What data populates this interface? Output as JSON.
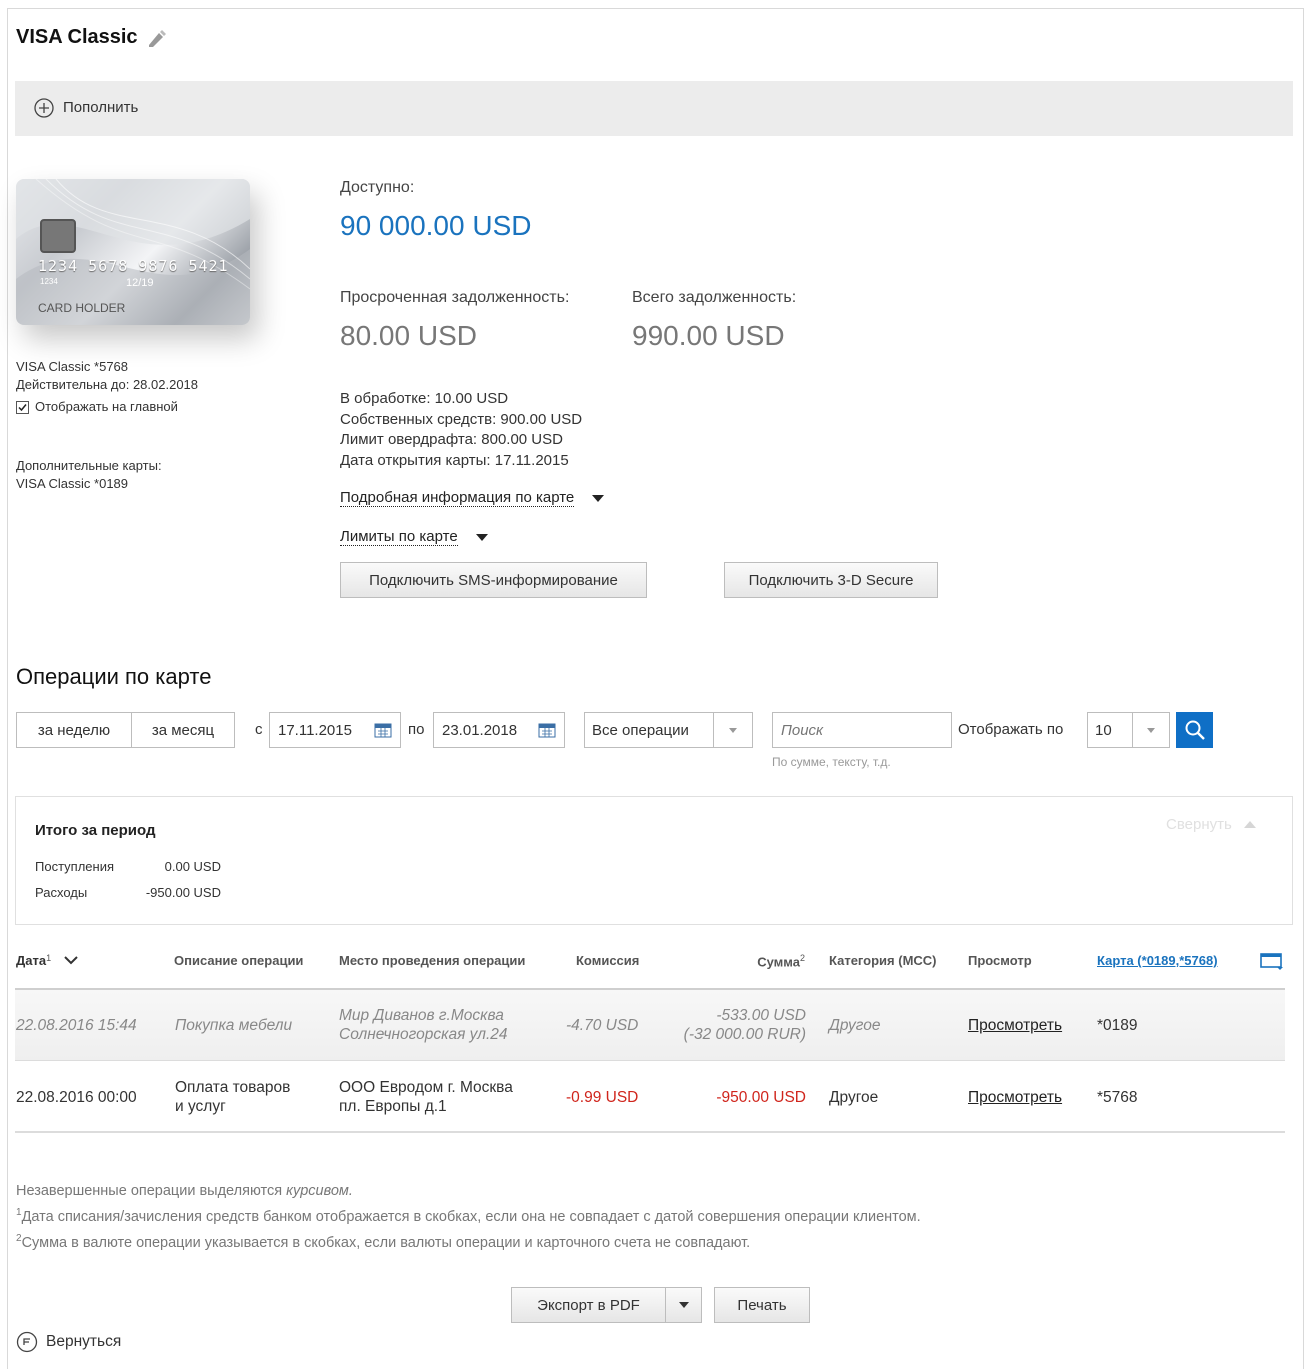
{
  "page": {
    "title": "VISA Classic",
    "topup_label": "Пополнить"
  },
  "card": {
    "image_number": "1234 5678 9876 5421",
    "image_small": "1234",
    "image_valid": "12/19",
    "image_holder": "CARD HOLDER",
    "name": "VISA Classic *5768",
    "valid_until": "Действительна до: 28.02.2018",
    "show_on_main_label": "Отображать на главной",
    "show_on_main_checked": true,
    "additional_title": "Дополнительные карты:",
    "additional_card": "VISA Classic *0189"
  },
  "balance": {
    "available_label": "Доступно:",
    "available_value": "90 000.00 USD",
    "overdue_label": "Просроченная задолженность:",
    "overdue_value": "80.00 USD",
    "total_debt_label": "Всего задолженность:",
    "total_debt_value": "990.00 USD",
    "processing": "В обработке: 10.00 USD",
    "own_funds": "Собственных средств: 900.00 USD",
    "overdraft": "Лимит овердрафта: 800.00 USD",
    "opened": "Дата открытия карты: 17.11.2015",
    "details_link": "Подробная информация по карте",
    "limits_link": "Лимиты по карте",
    "sms_button": "Подключить SMS-информирование",
    "secure_button": "Подключить 3-D Secure"
  },
  "operations": {
    "title": "Операции по карте",
    "week_button": "за неделю",
    "month_button": "за месяц",
    "from_label": "с",
    "date_from": "17.11.2015",
    "to_label": "по",
    "date_to": "23.01.2018",
    "type_select": "Все операции",
    "search_placeholder": "Поиск",
    "search_hint": "По сумме, тексту, т.д.",
    "show_by_label": "Отображать по",
    "show_by_value": "10"
  },
  "summary": {
    "title": "Итого за период",
    "collapse_label": "Свернуть",
    "income_label": "Поступления",
    "income_value": "0.00 USD",
    "expense_label": "Расходы",
    "expense_value": "-950.00 USD"
  },
  "table": {
    "headers": {
      "date": "Дата",
      "date_sup": "1",
      "description": "Описание операции",
      "place": "Место проведения операции",
      "fee": "Комиссия",
      "amount": "Сумма",
      "amount_sup": "2",
      "category": "Категория (MCC)",
      "view": "Просмотр",
      "card": "Карта (*0189,*5768)"
    },
    "rows": [
      {
        "date": "22.08.2016 15:44",
        "desc_line1": "Покупка мебели",
        "desc_line2": "",
        "place_line1": "Мир Диванов г.Москва",
        "place_line2": "Солнечногорская ул.24",
        "fee": "-4.70 USD",
        "amount_line1": "-533.00 USD",
        "amount_line2": "(-32 000.00 RUR)",
        "category": "Другое",
        "view": "Просмотреть",
        "card": "*0189"
      },
      {
        "date": "22.08.2016 00:00",
        "desc_line1": "Оплата товаров",
        "desc_line2": "и услуг",
        "place_line1": "ООО Евродом г. Москва",
        "place_line2": "пл. Европы д.1",
        "fee": "-0.99 USD",
        "amount_line1": "-950.00 USD",
        "amount_line2": "",
        "category": "Другое",
        "view": "Просмотреть",
        "card": "*5768"
      }
    ]
  },
  "footnotes": {
    "line0_text": "Незавершенные операции выделяются ",
    "line0_italic": "курсивом.",
    "line1_sup": "1",
    "line1": "Дата списания/зачисления средств банком отображается в скобках, если она не совпадает с датой совершения операции клиентом.",
    "line2_sup": "2",
    "line2": "Сумма в валюте операции указывается в скобках, если валюты операции и карточного счета не совпадают."
  },
  "actions": {
    "export_pdf": "Экспорт в PDF",
    "print": "Печать",
    "back": "Вернуться"
  },
  "colors": {
    "accent_blue": "#1a73be",
    "negative_red": "#d0251c",
    "search_button": "#0f6fc6"
  }
}
